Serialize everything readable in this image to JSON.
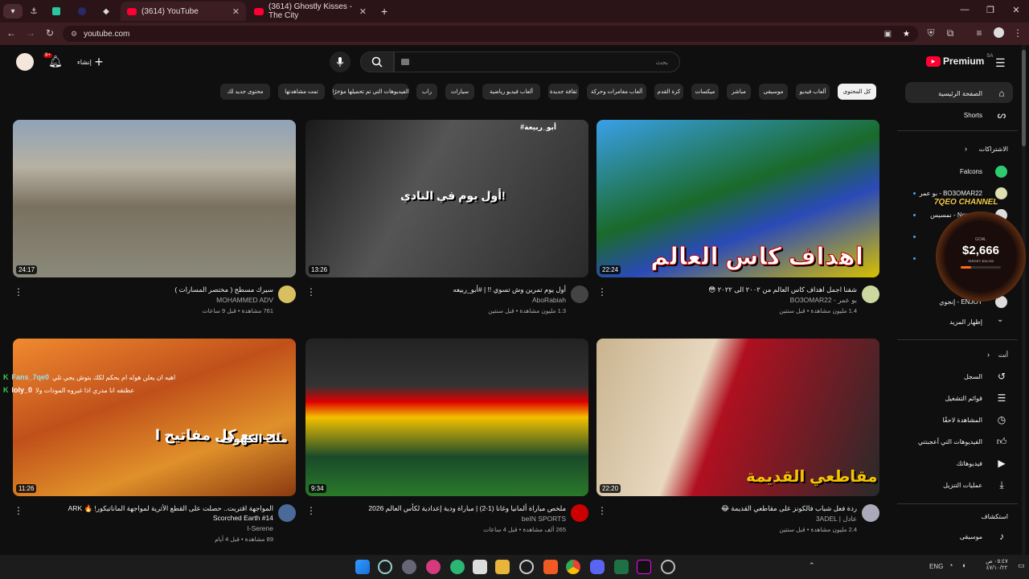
{
  "browser": {
    "tabs": [
      {
        "title": "(3614) YouTube"
      },
      {
        "title": "(3614) Ghostly Kisses - The City"
      }
    ],
    "url": "youtube.com"
  },
  "header": {
    "logo": "Premium",
    "logo_sup": "SA",
    "search_placeholder": "بحث",
    "create_label": "إنشاء",
    "notif_badge": "9+"
  },
  "chips": [
    "كل المحتوى",
    "ألعاب فيديو",
    "موسيقى",
    "مباشر",
    "ميكسات",
    "كرة القدم",
    "ألعاب مغامرات وحركة",
    "ثقافة جديدة",
    "ألعاب فيديو رياضية",
    "سيارات",
    "راب",
    "الفيديوهات التي تم تحميلها مؤخرًا",
    "تمت مشاهدتها",
    "محتوى جديد لك"
  ],
  "videos": [
    {
      "duration": "22:24",
      "title": "شفنا اجمل اهداف كاس العالم من ٢٠٠٢ الى ٢٠٢٢ 😳",
      "channel": "BO3OMAR22 - بو عمر",
      "meta": "1.4 مليون مشاهدة • قبل سنتين",
      "overlay": "اهداف كاس العالم"
    },
    {
      "duration": "13:26",
      "title": "أول يوم تمرين وش تسوي !! | #أبو_ربيعه",
      "channel": "AboRabiah",
      "meta": "1.3 مليون مشاهدة • قبل سنتين",
      "overlay": "أول يوم في النادي!",
      "tag": "#أبو_ربيعة"
    },
    {
      "duration": "24:17",
      "title": "سيرك مسطح ( مختصر المسارات )",
      "channel": "MOHAMMED ADV",
      "meta": "761 مشاهدة • قبل 9 ساعات"
    },
    {
      "duration": "22:20",
      "title": "ردة فعل شباب فالكونز على مقاطعي القديمة 😂",
      "channel": "3ADEL | عادل",
      "meta": "2.4 مليون مشاهدة • قبل سنتين",
      "overlay": "مقاطعي القديمة"
    },
    {
      "duration": "9:34",
      "title": "ملخص مباراة ألمانيا وغانا (1-2) | مباراة ودية إعدادية لكأس العالم 2026",
      "channel": "beIN SPORTS",
      "meta": "265 ألف مشاهدة • قبل 4 ساعات"
    },
    {
      "duration": "11:26",
      "title": "المواجهة اقتربت.. حصلت على القطع الأثرية لمواجهة الماناتيكور! 🔥 ARK",
      "title2": "Scorched Earth #14",
      "channel": "I-Serene",
      "meta": "89 مشاهدة • قبل 4 أيام",
      "overlay": "تجميع كل مفاتيح ا",
      "overlay2": "ملك الكهوف"
    }
  ],
  "sidebar": {
    "home": "الصفحة الرئيسية",
    "shorts": "Shorts",
    "subs_header": "الاشتراكات",
    "subs": [
      "Falcons",
      "BO3OMAR22 - بو عمر",
      "Nemesis - نمسيس",
      "",
      "",
      "",
      "ENJOY - إنجوي"
    ],
    "show_more": "إظهار المزيد",
    "you_header": "أنت",
    "you": [
      "السجل",
      "قوائم التشغيل",
      "المشاهدة لاحقًا",
      "الفيديوهات التي أعجبتني",
      "فيديوهاتك",
      "عمليات التنزيل"
    ],
    "explore_header": "استكشاف",
    "explore": [
      "موسيقى"
    ]
  },
  "overlays": {
    "channel_banner": "7QEO CHANNEL",
    "goal_label": "GOAL",
    "goal_amount": "$2,666",
    "target": "TARGET: $10,000"
  },
  "chat": [
    {
      "name": "Fans_7qe0",
      "msg": "اهيه ان يعلن هوله ام بحكم لكك بتوش يجي تلي"
    },
    {
      "name": "loly_0",
      "msg": "عظتقه انا مدري اذا غيروه المودات ولا"
    }
  ],
  "taskbar": {
    "lang": "ENG",
    "time": "٠٥:٤٧ ص",
    "date": "٤٧/١٠/٢٢"
  },
  "colors": {
    "youtube_red": "#ff0033",
    "bg": "#0f0f0f",
    "chip": "#272727"
  }
}
